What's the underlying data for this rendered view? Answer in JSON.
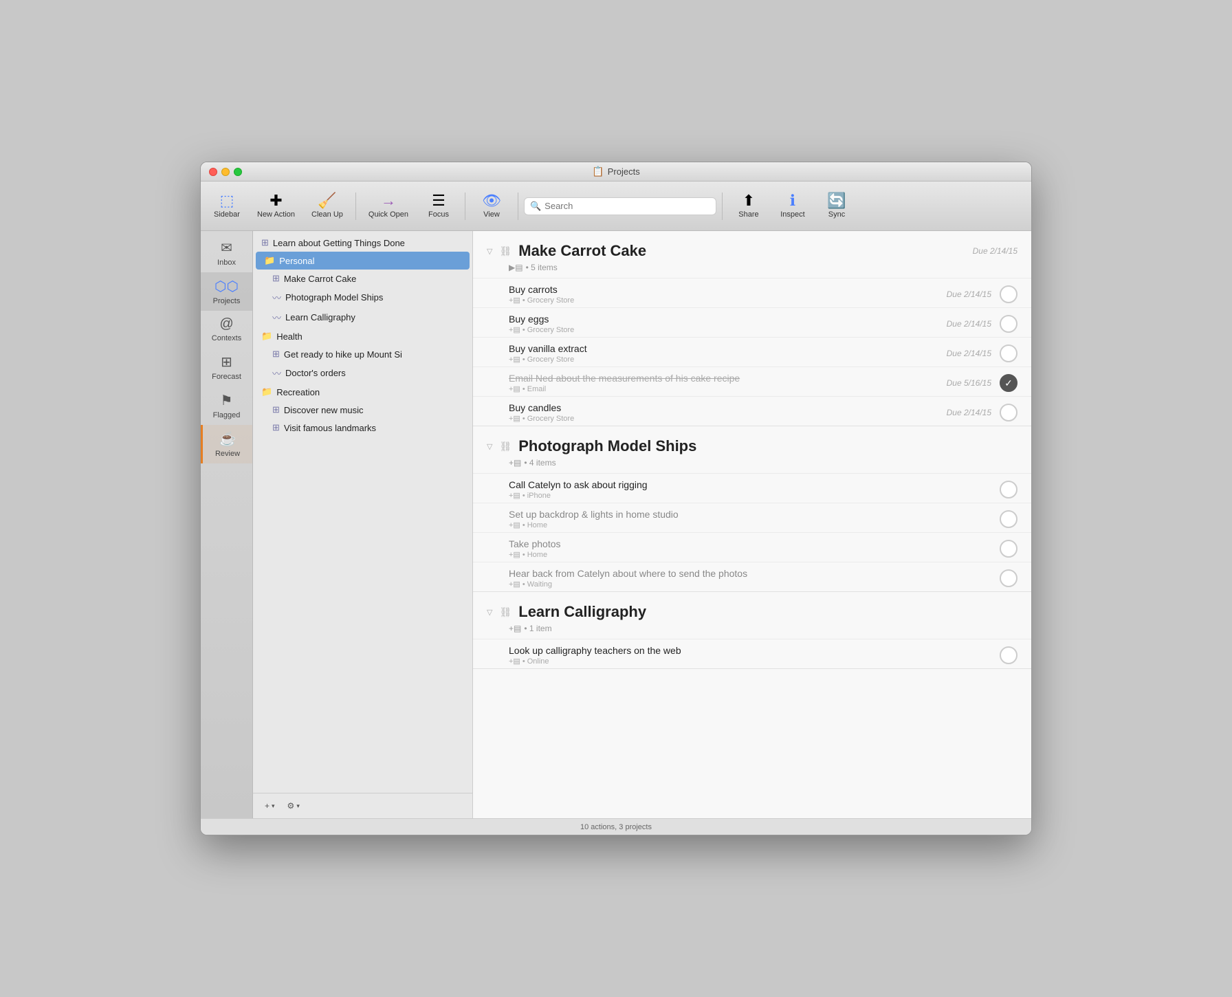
{
  "window": {
    "title": "Projects"
  },
  "toolbar": {
    "sidebar_label": "Sidebar",
    "new_action_label": "New Action",
    "clean_up_label": "Clean Up",
    "quick_open_label": "Quick Open",
    "focus_label": "Focus",
    "view_label": "View",
    "search_placeholder": "Search",
    "search_label": "Search",
    "share_label": "Share",
    "inspect_label": "Inspect",
    "sync_label": "Sync"
  },
  "nav": {
    "items": [
      {
        "id": "inbox",
        "label": "Inbox",
        "icon": "✉"
      },
      {
        "id": "projects",
        "label": "Projects",
        "icon": "⬡",
        "active": true
      },
      {
        "id": "contexts",
        "label": "Contexts",
        "icon": "@"
      },
      {
        "id": "forecast",
        "label": "Forecast",
        "icon": "⊞"
      },
      {
        "id": "flagged",
        "label": "Flagged",
        "icon": "⚑"
      },
      {
        "id": "review",
        "label": "Review",
        "icon": "☕"
      }
    ]
  },
  "sidebar": {
    "items": [
      {
        "id": "gtd",
        "label": "Learn about Getting Things Done",
        "type": "top",
        "icon": "⊞"
      },
      {
        "id": "personal",
        "label": "Personal",
        "type": "folder",
        "selected": true
      },
      {
        "id": "carrot",
        "label": "Make Carrot Cake",
        "type": "child",
        "icon": "⊞"
      },
      {
        "id": "ships",
        "label": "Photograph Model Ships",
        "type": "child",
        "icon": "〰"
      },
      {
        "id": "calligraphy",
        "label": "Learn Calligraphy",
        "type": "child",
        "icon": "〰"
      },
      {
        "id": "health",
        "label": "Health",
        "type": "folder"
      },
      {
        "id": "mount_si",
        "label": "Get ready to hike up Mount Si",
        "type": "child2",
        "icon": "⊞"
      },
      {
        "id": "doctors",
        "label": "Doctor's orders",
        "type": "child2",
        "icon": "〰"
      },
      {
        "id": "recreation",
        "label": "Recreation",
        "type": "folder"
      },
      {
        "id": "music",
        "label": "Discover new music",
        "type": "child2",
        "icon": "⊞"
      },
      {
        "id": "landmarks",
        "label": "Visit famous landmarks",
        "type": "child2",
        "icon": "⊞"
      }
    ],
    "footer": {
      "add_label": "+ ▾",
      "settings_label": "⚙ ▾"
    }
  },
  "projects": [
    {
      "id": "carrot_cake",
      "title": "Make Carrot Cake",
      "meta": "5 items",
      "due": "Due 2/14/15",
      "tasks": [
        {
          "id": "t1",
          "name": "Buy carrots",
          "sub_icon": "+▤",
          "sub_context": "Grocery Store",
          "due": "Due 2/14/15",
          "checked": false,
          "completed": false
        },
        {
          "id": "t2",
          "name": "Buy eggs",
          "sub_icon": "+▤",
          "sub_context": "Grocery Store",
          "due": "Due 2/14/15",
          "checked": false,
          "completed": false
        },
        {
          "id": "t3",
          "name": "Buy vanilla extract",
          "sub_icon": "+▤",
          "sub_context": "Grocery Store",
          "due": "Due 2/14/15",
          "checked": false,
          "completed": false
        },
        {
          "id": "t4",
          "name": "Email Ned about the measurements of his cake recipe",
          "sub_icon": "+▤",
          "sub_context": "Email",
          "due": "Due 5/16/15",
          "checked": true,
          "completed": true
        },
        {
          "id": "t5",
          "name": "Buy candles",
          "sub_icon": "+▤",
          "sub_context": "Grocery Store",
          "due": "Due 2/14/15",
          "checked": false,
          "completed": false
        }
      ]
    },
    {
      "id": "model_ships",
      "title": "Photograph Model Ships",
      "meta": "4 items",
      "due": "",
      "tasks": [
        {
          "id": "t6",
          "name": "Call Catelyn to ask about rigging",
          "sub_icon": "+▤",
          "sub_context": "iPhone",
          "due": "",
          "checked": false,
          "completed": false
        },
        {
          "id": "t7",
          "name": "Set up backdrop & lights in home studio",
          "sub_icon": "+▤",
          "sub_context": "Home",
          "due": "",
          "checked": false,
          "completed": false
        },
        {
          "id": "t8",
          "name": "Take photos",
          "sub_icon": "+▤",
          "sub_context": "Home",
          "due": "",
          "checked": false,
          "completed": false
        },
        {
          "id": "t9",
          "name": "Hear back from Catelyn about where to send the photos",
          "sub_icon": "+▤",
          "sub_context": "Waiting",
          "due": "",
          "checked": false,
          "completed": false
        }
      ]
    },
    {
      "id": "calligraphy",
      "title": "Learn Calligraphy",
      "meta": "1 item",
      "due": "",
      "tasks": [
        {
          "id": "t10",
          "name": "Look up calligraphy teachers on the web",
          "sub_icon": "+▤",
          "sub_context": "Online",
          "due": "",
          "checked": false,
          "completed": false
        }
      ]
    }
  ],
  "status_bar": {
    "text": "10 actions, 3 projects"
  }
}
